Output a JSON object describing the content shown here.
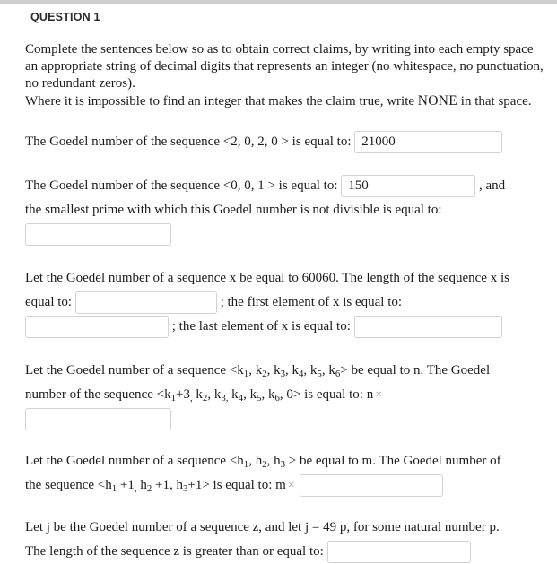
{
  "header": {
    "question_label": "QUESTION 1"
  },
  "instructions": {
    "line1": "Complete the sentences below so as to obtain correct claims, by writing into each empty space an appropriate string of decimal digits that represents an integer (no whitespace, no punctuation, no redundant zeros).",
    "line2_a": "Where it is impossible to find an integer that makes the claim true, write",
    "line2_none": "NONE",
    "line2_b": "in that space."
  },
  "items": [
    {
      "id": "q1a",
      "text_before": "The  Goedel  number  of the sequence  <2, 0, 2, 0 >  is equal to:",
      "field_value": "21000",
      "field_placeholder": ""
    },
    {
      "id": "q1b",
      "text_before": "The Goedel  number  of the sequence  <0, 0, 1 >  is equal to:",
      "field_value": "150",
      "text_after": ", and",
      "text_line2": "the smallest prime with which this Goedel  number is not divisible is equal to:",
      "field2_value": "",
      "field2_placeholder": ""
    },
    {
      "id": "q1c",
      "text_line1": "Let the Goedel number of a sequence  x  be equal to 60060.   The length of the sequence x is",
      "text_line2_a": "equal to:",
      "field1_value": "",
      "text_line2_b": "; the first element of x is equal to:",
      "field2_value": "",
      "text_line3": "; the last element of x is equal to:",
      "field3_value": ""
    },
    {
      "id": "q1d",
      "text_line1_a": "Let the Goedel number of a sequence  <k",
      "text_line1_subs": [
        "1",
        "2",
        "3",
        "4",
        "5",
        "6"
      ],
      "text_line1_b": "be equal to  n.   The Goedel",
      "text_line2_a": "number of the sequence  <k",
      "text_line2_b": "is equal to:",
      "multiplier_label": "n",
      "times_symbol": "×",
      "field_value": ""
    },
    {
      "id": "q1e",
      "text_line1": "Let the Goedel number of a sequence  <h",
      "text_line1_b": "be equal to  m.   The Goedel number of",
      "text_line2_a": "the sequence <h",
      "text_line2_b": "is equal to:",
      "multiplier_label": "m",
      "times_symbol": "×",
      "field_value": ""
    },
    {
      "id": "q1f",
      "text_line1": "Let  j  be the Goedel number of a sequence  z, and let  j =  49 p,  for some natural number p.",
      "text_line2": "The length of the sequence z is greater than or equal to:",
      "field_value": ""
    }
  ],
  "theme": {
    "topbar_color": "#cfcfcf",
    "input_border": "#d2d2d2",
    "text_color": "#1c1c1c",
    "times_color": "#9a9a9a",
    "background": "#ffffff"
  }
}
